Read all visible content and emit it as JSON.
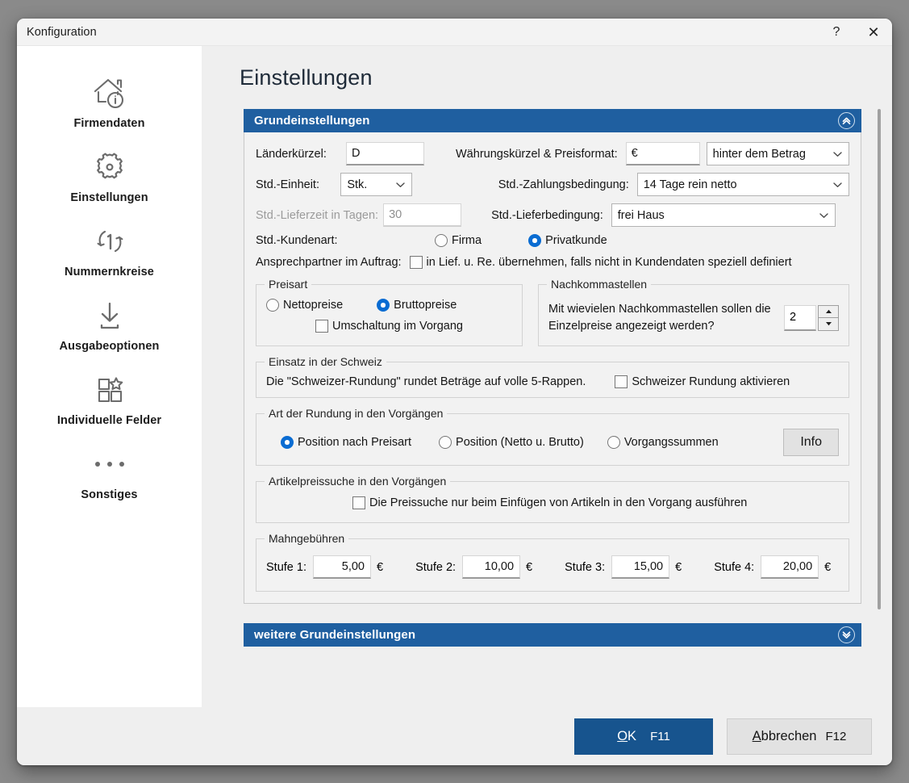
{
  "window": {
    "title": "Konfiguration",
    "help_button": "?",
    "close_button": "✕"
  },
  "sidebar": {
    "items": [
      {
        "label": "Firmendaten",
        "icon": "house-info-icon"
      },
      {
        "label": "Einstellungen",
        "icon": "gear-icon"
      },
      {
        "label": "Nummernkreise",
        "icon": "number-cycle-icon"
      },
      {
        "label": "Ausgabeoptionen",
        "icon": "download-icon"
      },
      {
        "label": "Individuelle Felder",
        "icon": "grid-star-icon"
      },
      {
        "label": "Sonstiges",
        "icon": "ellipsis-icon"
      }
    ]
  },
  "page": {
    "title": "Einstellungen"
  },
  "sections": {
    "main": {
      "title": "Grundeinstellungen",
      "collapse_icon": "chevron-double-up-icon"
    },
    "more": {
      "title": "weitere Grundeinstellungen",
      "expand_icon": "chevron-double-down-icon"
    }
  },
  "form": {
    "laenderkuerzel": {
      "label": "Länderkürzel:",
      "value": "D"
    },
    "waehrung": {
      "label": "Währungskürzel & Preisformat:",
      "value": "€",
      "format_selected": "hinter dem Betrag"
    },
    "std_einheit": {
      "label": "Std.-Einheit:",
      "selected": "Stk."
    },
    "std_zahlungsbedingung": {
      "label": "Std.-Zahlungsbedingung:",
      "selected": "14 Tage rein netto"
    },
    "std_lieferzeit": {
      "label": "Std.-Lieferzeit in Tagen:",
      "value": "30",
      "disabled": true
    },
    "std_lieferbedingung": {
      "label": "Std.-Lieferbedingung:",
      "selected": "frei Haus"
    },
    "std_kundenart": {
      "label": "Std.-Kundenart:",
      "options": [
        {
          "label": "Firma",
          "selected": false
        },
        {
          "label": "Privatkunde",
          "selected": true
        }
      ]
    },
    "ansprechpartner": {
      "label": "Ansprechpartner im Auftrag:",
      "checkbox_label": "in Lief. u. Re. übernehmen, falls nicht in Kundendaten speziell definiert",
      "checked": false
    }
  },
  "groups": {
    "preisart": {
      "title": "Preisart",
      "options": [
        {
          "label": "Nettopreise",
          "selected": false
        },
        {
          "label": "Bruttopreise",
          "selected": true
        }
      ],
      "checkbox_label": "Umschaltung im Vorgang",
      "checked": false
    },
    "nachkommastellen": {
      "title": "Nachkommastellen",
      "question_line1": "Mit wievielen Nachkommastellen sollen die",
      "question_line2": "Einzelpreise angezeigt werden?",
      "value": "2",
      "up_icon": "triangle-up-icon",
      "down_icon": "triangle-down-icon"
    },
    "schweiz": {
      "title": "Einsatz in der Schweiz",
      "description": "Die \"Schweizer-Rundung\" rundet Beträge auf volle 5-Rappen.",
      "checkbox_label": "Schweizer Rundung aktivieren",
      "checked": false
    },
    "rundung": {
      "title": "Art der Rundung in den Vorgängen",
      "options": [
        {
          "label": "Position nach Preisart",
          "selected": true
        },
        {
          "label": "Position (Netto u. Brutto)",
          "selected": false
        },
        {
          "label": "Vorgangssummen",
          "selected": false
        }
      ],
      "info_button": "Info"
    },
    "artikelpreissuche": {
      "title": "Artikelpreissuche in den Vorgängen",
      "checkbox_label": "Die Preissuche nur beim Einfügen von Artikeln in den Vorgang ausführen",
      "checked": false
    },
    "mahngebuehren": {
      "title": "Mahngebühren",
      "currency": "€",
      "levels": [
        {
          "label": "Stufe 1:",
          "value": "5,00"
        },
        {
          "label": "Stufe 2:",
          "value": "10,00"
        },
        {
          "label": "Stufe 3:",
          "value": "15,00"
        },
        {
          "label": "Stufe 4:",
          "value": "20,00"
        }
      ]
    }
  },
  "footer": {
    "ok": {
      "accel": "O",
      "rest": "K",
      "fkey": "F11"
    },
    "cancel": {
      "accel": "A",
      "rest": "bbrechen",
      "fkey": "F12"
    }
  },
  "colors": {
    "section_blue": "#1f5fa0",
    "ok_blue": "#17548e",
    "radio_blue": "#0a6cd2"
  }
}
